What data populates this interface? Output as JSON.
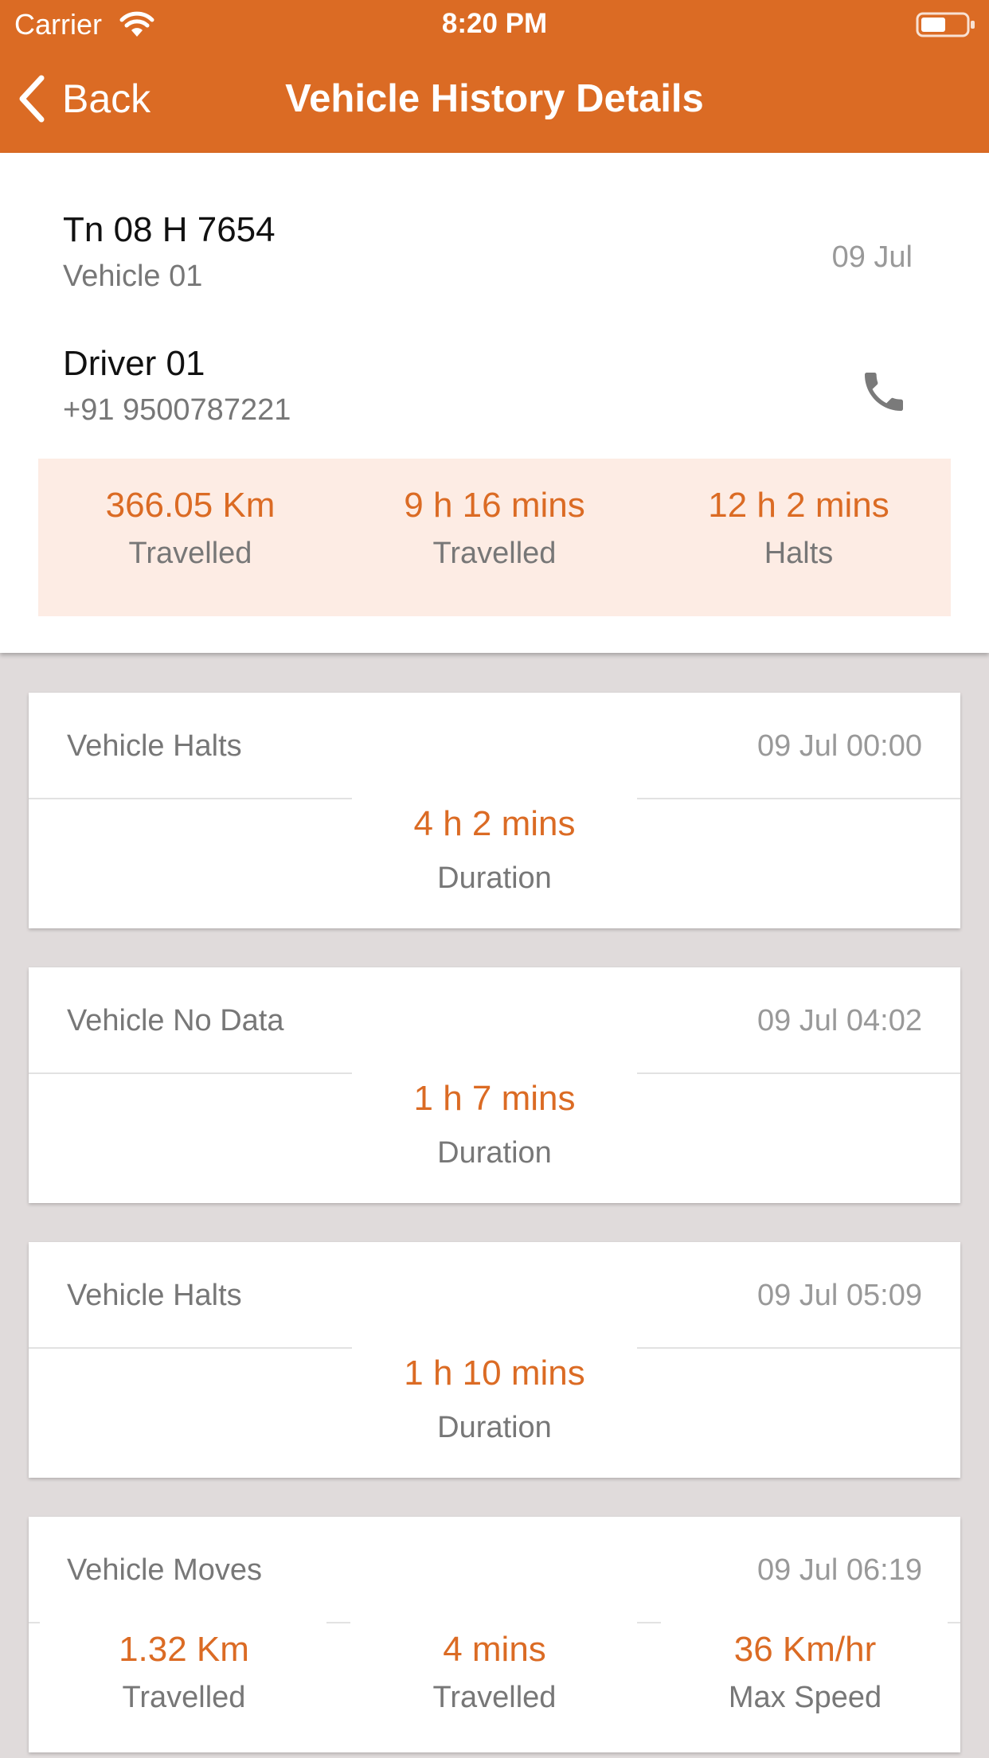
{
  "status_bar": {
    "carrier": "Carrier",
    "time": "8:20 PM"
  },
  "nav": {
    "back_label": "Back",
    "title": "Vehicle History Details"
  },
  "summary": {
    "plate": "Tn 08 H 7654",
    "vehicle_name": "Vehicle 01",
    "date": "09 Jul",
    "driver_name": "Driver 01",
    "driver_phone": "+91 9500787221",
    "stats": [
      {
        "value": "366.05 Km",
        "label": "Travelled"
      },
      {
        "value": "9 h 16 mins",
        "label": "Travelled"
      },
      {
        "value": "12 h 2 mins",
        "label": "Halts"
      }
    ]
  },
  "events": [
    {
      "title": "Vehicle Halts",
      "time": "09 Jul 00:00",
      "value": "4 h 2 mins",
      "label": "Duration"
    },
    {
      "title": "Vehicle No Data",
      "time": "09 Jul 04:02",
      "value": "1 h 7 mins",
      "label": "Duration"
    },
    {
      "title": "Vehicle Halts",
      "time": "09 Jul 05:09",
      "value": "1 h 10 mins",
      "label": "Duration"
    },
    {
      "title": "Vehicle Moves",
      "time": "09 Jul 06:19",
      "stats": [
        {
          "value": "1.32 Km",
          "label": "Travelled"
        },
        {
          "value": "4 mins",
          "label": "Travelled"
        },
        {
          "value": "36 Km/hr",
          "label": "Max Speed"
        }
      ]
    }
  ],
  "colors": {
    "accent": "#db6b24",
    "stats_background": "#fdece4",
    "list_background": "#e0dbdb"
  },
  "icons": {
    "back": "chevron-left-icon",
    "call": "phone-icon",
    "wifi": "wifi-icon",
    "battery": "battery-icon"
  }
}
